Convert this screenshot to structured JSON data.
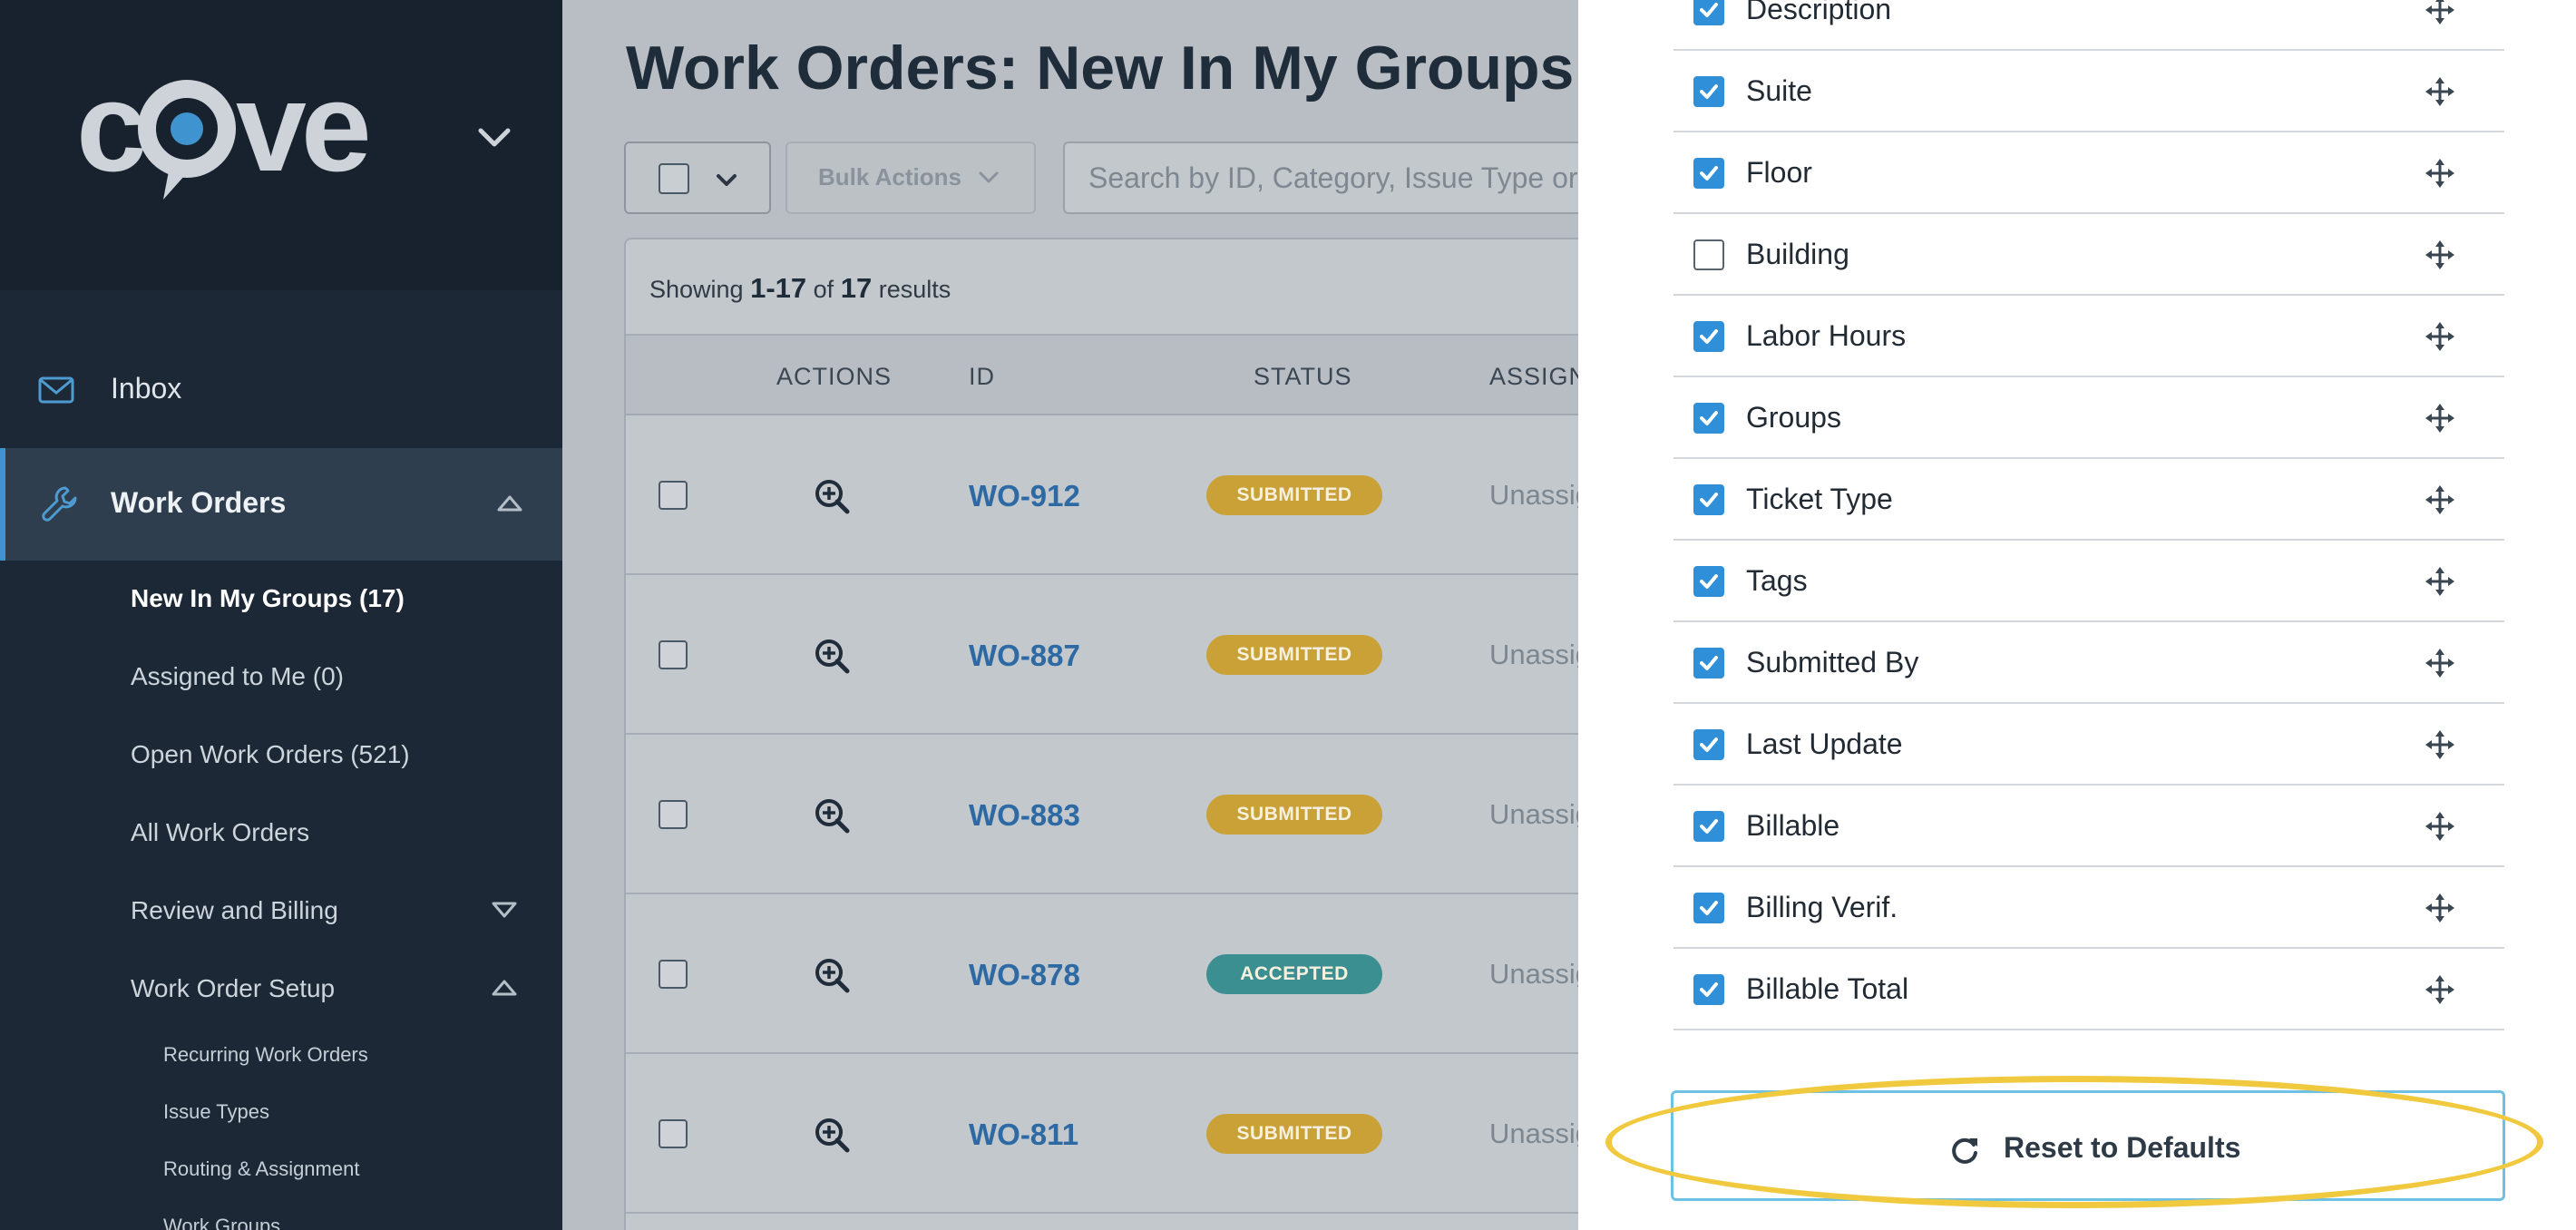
{
  "colors": {
    "sidebar_bg": "#1c2836",
    "accent": "#3f94cf",
    "link": "#2d6aa3",
    "submitted": "#c9a137",
    "accepted": "#3c8f91",
    "highlight": "#f0c93f"
  },
  "sidebar": {
    "logo": "cove",
    "nav": [
      {
        "label": "Inbox",
        "icon": "envelope-icon"
      },
      {
        "label": "Work Orders",
        "icon": "wrench-icon"
      }
    ],
    "sub_items": [
      "New In My Groups (17)",
      "Assigned to Me (0)",
      "Open Work Orders (521)",
      "All Work Orders",
      "Review and Billing",
      "Work Order Setup"
    ],
    "subsub_items": [
      "Recurring Work Orders",
      "Issue Types",
      "Routing & Assignment",
      "Work Groups"
    ]
  },
  "main": {
    "title": "Work Orders: New In My Groups",
    "bulk_actions_label": "Bulk Actions",
    "search_placeholder": "Search by ID, Category, Issue Type or Text",
    "results": {
      "prefix": "Showing",
      "range": "1-17",
      "of": "of",
      "total": "17",
      "suffix": "results"
    },
    "columns": [
      "ACTIONS",
      "ID",
      "STATUS",
      "ASSIGNEE"
    ],
    "rows": [
      {
        "id": "WO-912",
        "status": "SUBMITTED",
        "assignee": "Unassigned"
      },
      {
        "id": "WO-887",
        "status": "SUBMITTED",
        "assignee": "Unassigned"
      },
      {
        "id": "WO-883",
        "status": "SUBMITTED",
        "assignee": "Unassigned"
      },
      {
        "id": "WO-878",
        "status": "ACCEPTED",
        "assignee": "Unassigned"
      },
      {
        "id": "WO-811",
        "status": "SUBMITTED",
        "assignee": "Unassigned"
      }
    ]
  },
  "panel": {
    "columns": [
      {
        "label": "Description",
        "checked": true
      },
      {
        "label": "Suite",
        "checked": true
      },
      {
        "label": "Floor",
        "checked": true
      },
      {
        "label": "Building",
        "checked": false
      },
      {
        "label": "Labor Hours",
        "checked": true
      },
      {
        "label": "Groups",
        "checked": true
      },
      {
        "label": "Ticket Type",
        "checked": true
      },
      {
        "label": "Tags",
        "checked": true
      },
      {
        "label": "Submitted By",
        "checked": true
      },
      {
        "label": "Last Update",
        "checked": true
      },
      {
        "label": "Billable",
        "checked": true
      },
      {
        "label": "Billing Verif.",
        "checked": true
      },
      {
        "label": "Billable Total",
        "checked": true
      }
    ],
    "reset_label": "Reset to Defaults"
  }
}
